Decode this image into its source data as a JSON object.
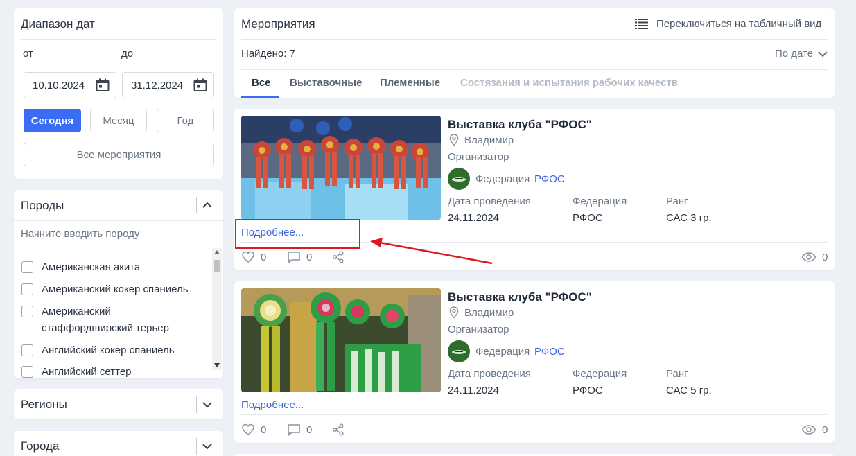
{
  "date_range": {
    "title": "Диапазон дат",
    "from_label": "от",
    "to_label": "до",
    "from_value": "10.10.2024",
    "to_value": "31.12.2024",
    "today_button": "Сегодня",
    "month_button": "Месяц",
    "year_button": "Год",
    "all_events_button": "Все мероприятия"
  },
  "breeds": {
    "title": "Породы",
    "search_placeholder": "Начните вводить породу",
    "items": [
      {
        "label": "Американская акита"
      },
      {
        "label": "Американский кокер спаниель"
      },
      {
        "label_line1": "Американский",
        "label_line2": "стаффордширский терьер"
      },
      {
        "label": "Английский кокер спаниель"
      },
      {
        "label": "Английский сеттер"
      }
    ]
  },
  "regions": {
    "title": "Регионы"
  },
  "cities": {
    "title": "Города"
  },
  "events": {
    "title": "Мероприятия",
    "switch_view": "Переключиться на табличный вид",
    "found": "Найдено: 7",
    "sort": "По дате",
    "tabs": [
      "Все",
      "Выставочные",
      "Племенные",
      "Состязания и испытания рабочих качеств"
    ],
    "items": [
      {
        "title": "Выставка клуба \"РФОС\"",
        "city": "Владимир",
        "organizer_label": "Организатор",
        "organizer_prefix": "Федерация",
        "organizer_name": "РФОС",
        "date_label": "Дата проведения",
        "date": "24.11.2024",
        "federation_label": "Федерация",
        "federation": "РФОС",
        "rank_label": "Ранг",
        "rank": "САС 3 гр.",
        "more": "Подробнее...",
        "likes": "0",
        "comments": "0",
        "views": "0"
      },
      {
        "title": "Выставка клуба \"РФОС\"",
        "city": "Владимир",
        "organizer_label": "Организатор",
        "organizer_prefix": "Федерация",
        "organizer_name": "РФОС",
        "date_label": "Дата проведения",
        "date": "24.11.2024",
        "federation_label": "Федерация",
        "federation": "РФОС",
        "rank_label": "Ранг",
        "rank": "САС 5 гр.",
        "more": "Подробнее...",
        "likes": "0",
        "comments": "0",
        "views": "0"
      }
    ]
  },
  "annotation": {
    "color": "#e0191f"
  }
}
